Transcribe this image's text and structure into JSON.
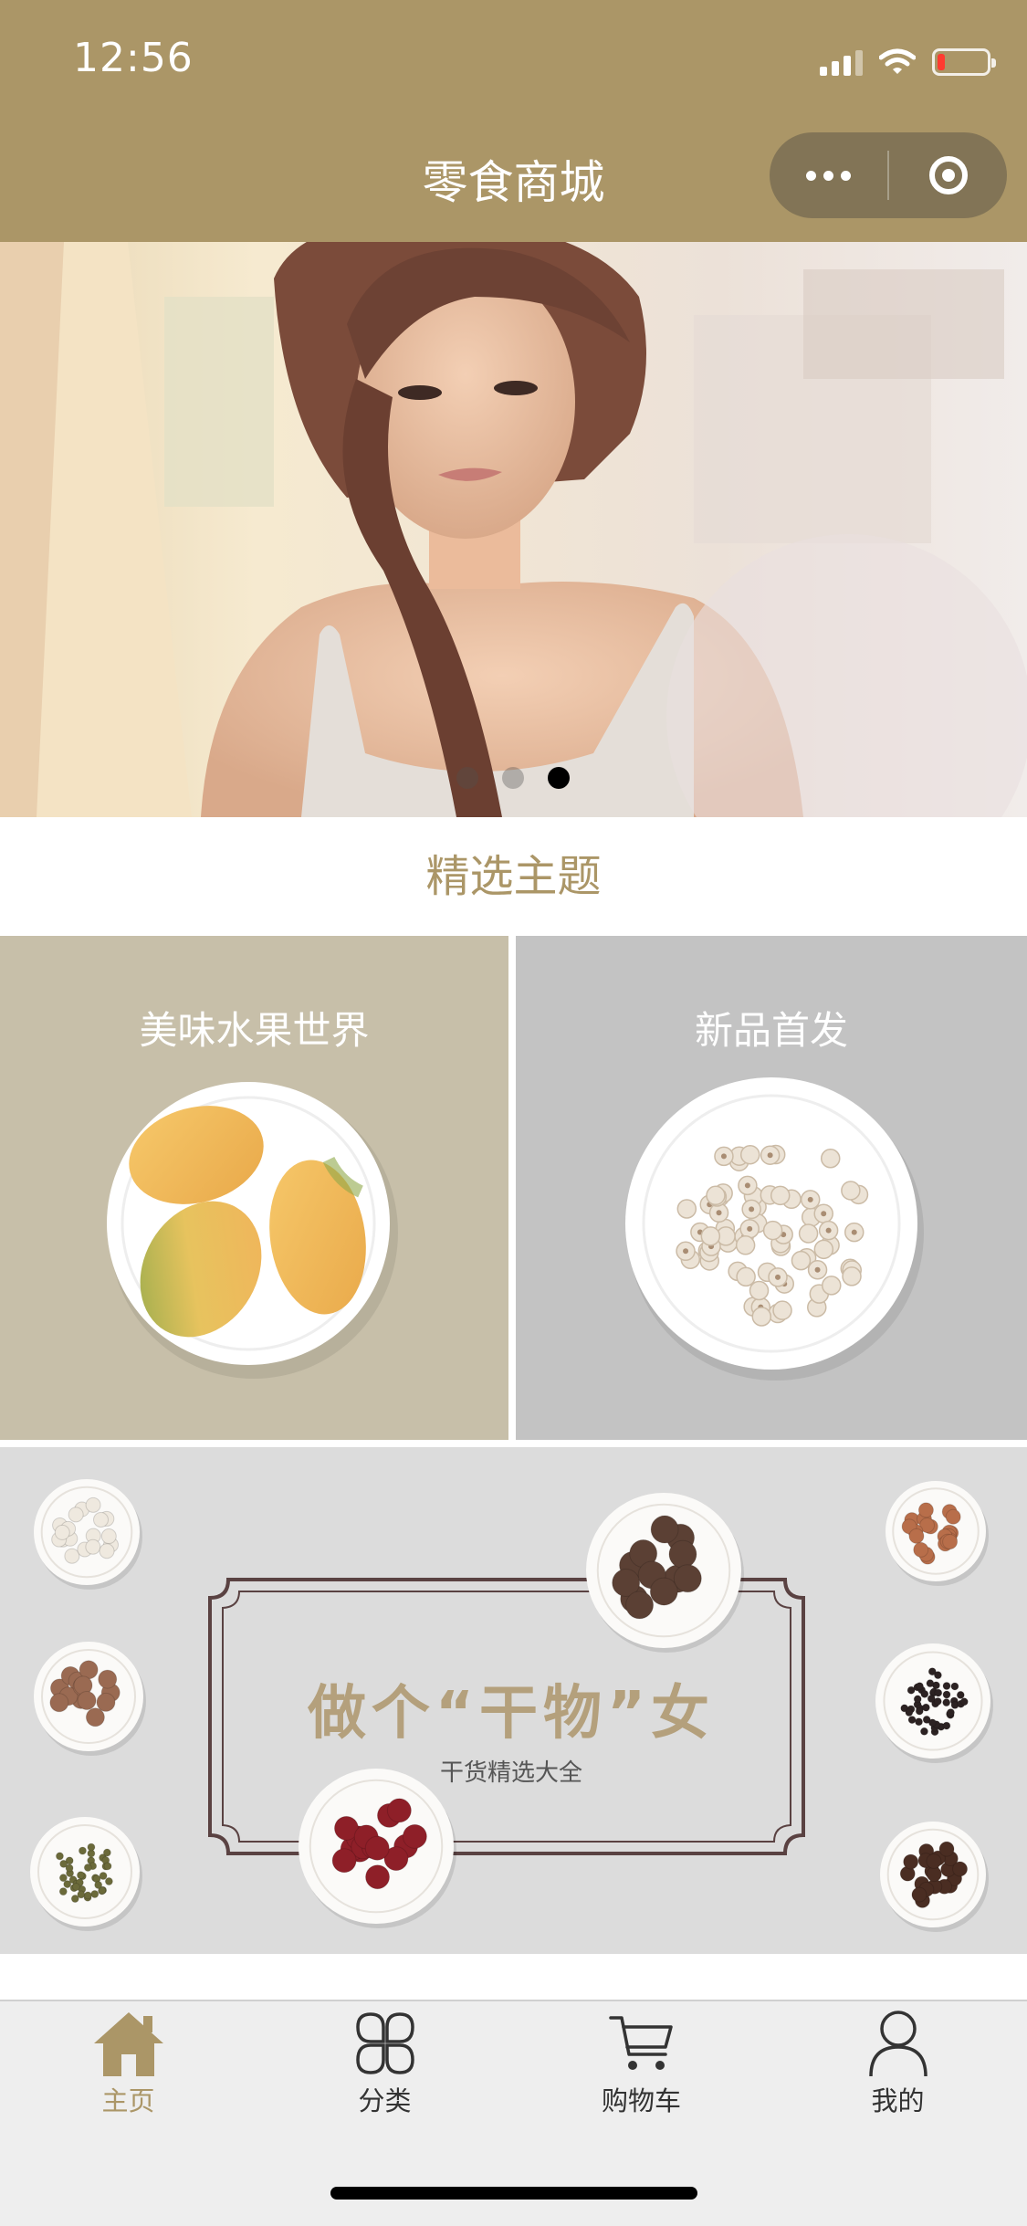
{
  "status_bar": {
    "time": "12:56",
    "battery_level": 0.15,
    "signal_bars_active": 3
  },
  "nav": {
    "title": "零食商城"
  },
  "banner": {
    "slide_count": 3,
    "active_slide": 3
  },
  "featured": {
    "title": "精选主题",
    "themes": [
      {
        "label": "美味水果世界",
        "bg_color": "#c7bfa9"
      },
      {
        "label": "新品首发",
        "bg_color": "#c3c3c3"
      }
    ]
  },
  "promo": {
    "title": "做个“干物”女",
    "subtitle": "干货精选大全"
  },
  "tabbar": {
    "active_color": "#ab9667",
    "items": [
      {
        "label": "主页",
        "icon": "home-icon",
        "active": true
      },
      {
        "label": "分类",
        "icon": "category-icon",
        "active": false
      },
      {
        "label": "购物车",
        "icon": "cart-icon",
        "active": false
      },
      {
        "label": "我的",
        "icon": "profile-icon",
        "active": false
      }
    ]
  },
  "colors": {
    "brand": "#ab9667"
  }
}
